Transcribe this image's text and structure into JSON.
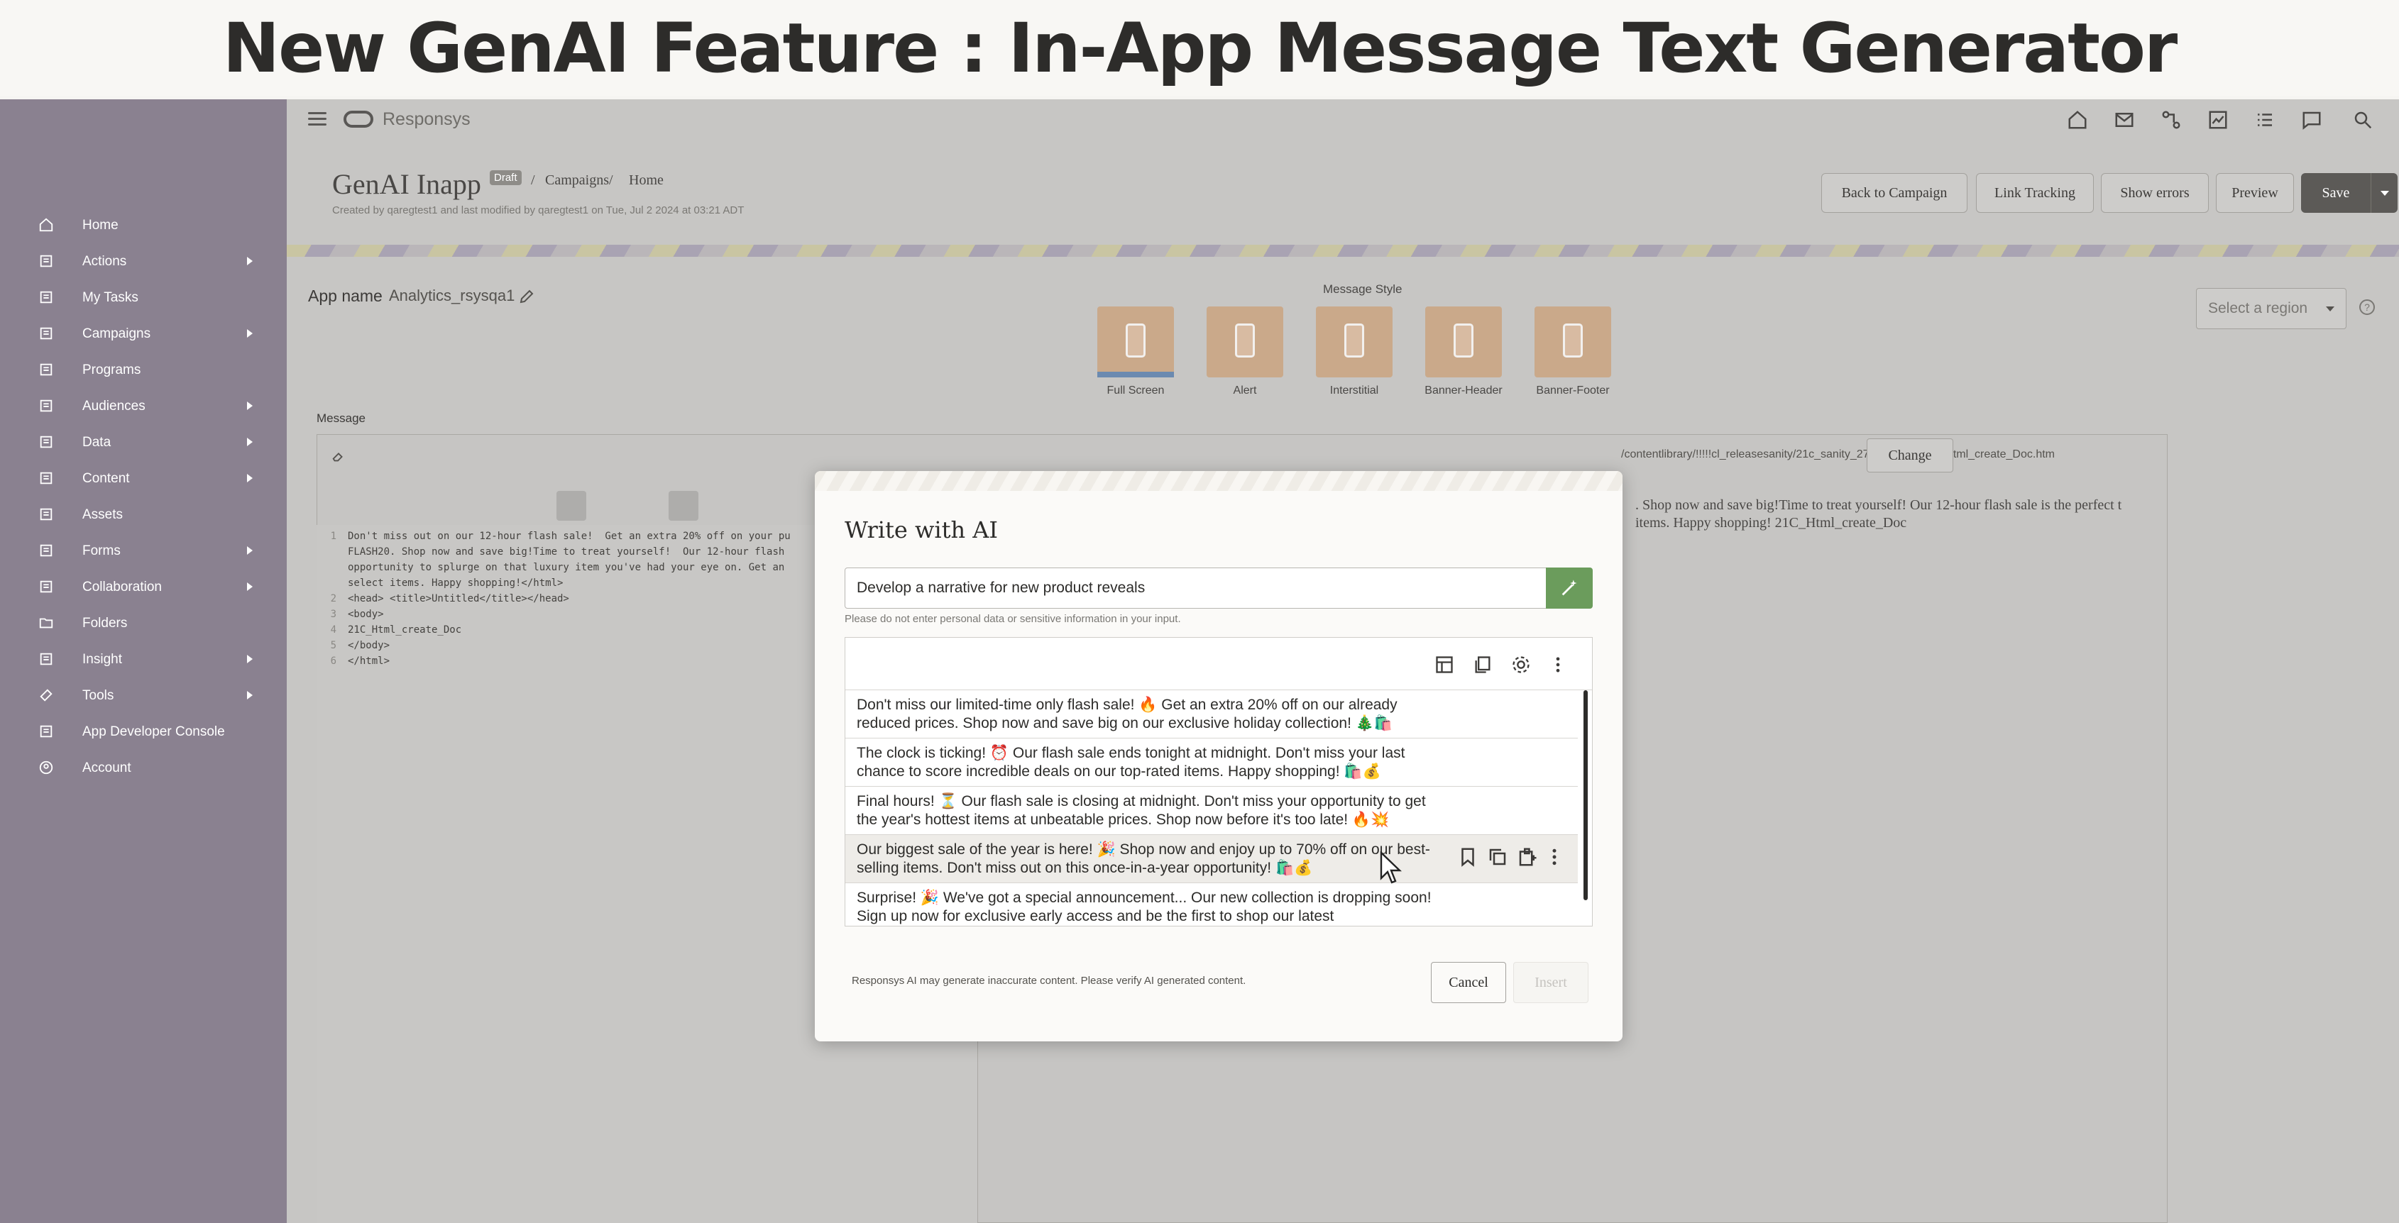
{
  "headline": "New GenAI Feature : In-App Message Text Generator",
  "sidebar": {
    "items": [
      {
        "label": "Home",
        "icon": "home-icon",
        "submenu": false
      },
      {
        "label": "Actions",
        "icon": "actions-icon",
        "submenu": true
      },
      {
        "label": "My Tasks",
        "icon": "tasks-icon",
        "submenu": false
      },
      {
        "label": "Campaigns",
        "icon": "campaigns-icon",
        "submenu": true
      },
      {
        "label": "Programs",
        "icon": "programs-icon",
        "submenu": false
      },
      {
        "label": "Audiences",
        "icon": "audiences-icon",
        "submenu": true
      },
      {
        "label": "Data",
        "icon": "data-icon",
        "submenu": true
      },
      {
        "label": "Content",
        "icon": "content-icon",
        "submenu": true
      },
      {
        "label": "Assets",
        "icon": "assets-icon",
        "submenu": false
      },
      {
        "label": "Forms",
        "icon": "forms-icon",
        "submenu": true
      },
      {
        "label": "Collaboration",
        "icon": "collaboration-icon",
        "submenu": true
      },
      {
        "label": "Folders",
        "icon": "folder-icon",
        "submenu": false
      },
      {
        "label": "Insight",
        "icon": "insight-icon",
        "submenu": true
      },
      {
        "label": "Tools",
        "icon": "tools-icon",
        "submenu": true
      },
      {
        "label": "App Developer Console",
        "icon": "developer-console-icon",
        "submenu": false
      },
      {
        "label": "Account",
        "icon": "account-icon",
        "submenu": false
      }
    ]
  },
  "topbar": {
    "brand": "Responsys"
  },
  "header": {
    "title": "GenAI Inapp",
    "badge": "Draft",
    "breadcrumbs": [
      "Campaigns",
      "Home"
    ],
    "meta": "Created by qaregtest1 and last modified by qaregtest1 on Tue, Jul 2 2024 at 03:21 ADT",
    "buttons": {
      "back": "Back to Campaign",
      "link_tracking": "Link Tracking",
      "show_errors": "Show errors",
      "preview": "Preview",
      "save": "Save"
    }
  },
  "app": {
    "name_label": "App name",
    "name_value": "Analytics_rsysqa1"
  },
  "message_style": {
    "label": "Message Style",
    "options": [
      "Full Screen",
      "Alert",
      "Interstitial",
      "Banner-Header",
      "Banner-Footer"
    ],
    "selected": "Full Screen"
  },
  "region": {
    "placeholder": "Select a region"
  },
  "message": {
    "label": "Message",
    "content_path": "/contentlibrary/!!!!!cl_releasesanity/21c_sanity_27-07-2021/21C_Html_create_Doc.htm",
    "change_label": "Change",
    "code_lines": [
      {
        "n": "1",
        "text": "Don't miss out on our 12-hour flash sale!  Get an extra 20% off on your pu"
      },
      {
        "n": "",
        "text": "FLASH20. Shop now and save big!Time to treat yourself!  Our 12-hour flash"
      },
      {
        "n": "",
        "text": "opportunity to splurge on that luxury item you've had your eye on. Get an"
      },
      {
        "n": "",
        "text": "select items. Happy shopping!</html>"
      },
      {
        "n": "2",
        "text": "<head> <title>Untitled</title></head>"
      },
      {
        "n": "3",
        "text": "<body>"
      },
      {
        "n": "4",
        "text": "21C_Html_create_Doc"
      },
      {
        "n": "5",
        "text": "</body>"
      },
      {
        "n": "6",
        "text": "</html>"
      }
    ],
    "preview": ". Shop now and save big!Time to treat yourself! Our 12-hour flash sale is the perfect t items. Happy shopping! 21C_Html_create_Doc"
  },
  "modal": {
    "title": "Write with AI",
    "prompt_value": "Develop a narrative for new product reveals",
    "privacy_note": "Please do not enter personal data or sensitive information in your input.",
    "results": [
      "Don't miss our limited-time only flash sale! 🔥 Get an extra 20% off on our already reduced prices. Shop now and save big on our exclusive holiday collection! 🎄🛍️",
      "The clock is ticking! ⏰ Our flash sale ends tonight at midnight. Don't miss your last chance to score incredible deals on our top-rated items. Happy shopping! 🛍️💰",
      "Final hours! ⏳ Our flash sale is closing at midnight. Don't miss your opportunity to get the year's hottest items at unbeatable prices. Shop now before it's too late! 🔥💥",
      "Our biggest sale of the year is here! 🎉 Shop now and enjoy up to 70% off on our best-selling items. Don't miss out on this once-in-a-year opportunity! 🛍️💰",
      "Surprise! 🎉 We've got a special announcement... Our new collection is dropping soon! Sign up now for exclusive early access and be the first to shop our latest"
    ],
    "disclaimer": "Responsys AI may generate inaccurate content. Please verify AI generated content.",
    "cancel_label": "Cancel",
    "insert_label": "Insert"
  }
}
